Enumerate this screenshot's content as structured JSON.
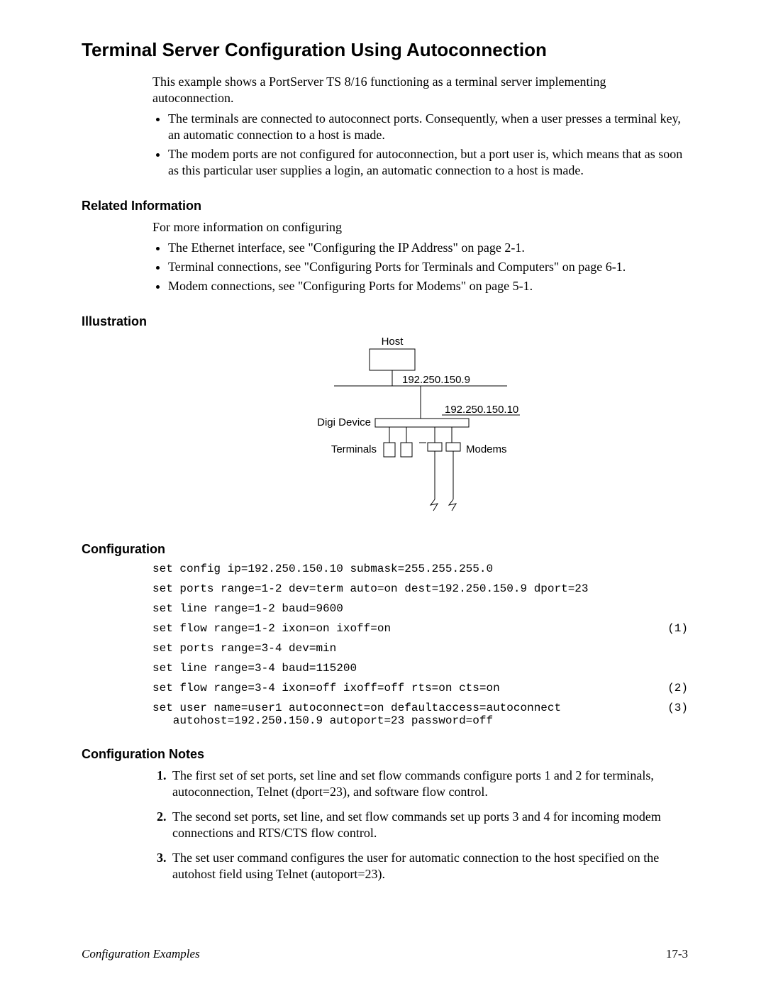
{
  "title": "Terminal Server Configuration Using Autoconnection",
  "intro": "This example shows a PortServer TS 8/16 functioning as a terminal server implementing autoconnection.",
  "intro_bullets": [
    "The terminals are connected to autoconnect ports. Consequently, when a user presses a terminal key, an automatic connection to a host is made.",
    "The modem ports are not configured for autoconnection, but a port user is, which means that as soon as this particular user supplies a login, an automatic connection to a host is made."
  ],
  "related": {
    "heading": "Related Information",
    "lead": "For more information on configuring",
    "items": [
      "The Ethernet interface, see \"Configuring the IP Address\" on page 2-1.",
      "Terminal connections, see \"Configuring Ports for Terminals and Computers\" on page 6-1.",
      "Modem connections, see \"Configuring Ports for Modems\" on page 5-1."
    ]
  },
  "illustration": {
    "heading": "Illustration",
    "labels": {
      "host": "Host",
      "host_ip": "192.250.150.9",
      "digi_ip": "192.250.150.10",
      "digi": "Digi Device",
      "terminals": "Terminals",
      "modems": "Modems"
    }
  },
  "configuration": {
    "heading": "Configuration",
    "lines": [
      {
        "cmd": "set config ip=192.250.150.10 submask=255.255.255.0",
        "num": ""
      },
      {
        "cmd": "set ports range=1-2 dev=term auto=on dest=192.250.150.9 dport=23",
        "num": ""
      },
      {
        "cmd": "set line range=1-2 baud=9600",
        "num": ""
      },
      {
        "cmd": "set flow range=1-2 ixon=on ixoff=on",
        "num": "(1)"
      },
      {
        "cmd": "set ports range=3-4 dev=min",
        "num": ""
      },
      {
        "cmd": "set line range=3-4 baud=115200",
        "num": ""
      },
      {
        "cmd": "set flow range=3-4 ixon=off ixoff=off rts=on cts=on",
        "num": "(2)"
      },
      {
        "cmd": "set user name=user1 autoconnect=on defaultaccess=autoconnect\n   autohost=192.250.150.9 autoport=23 password=off",
        "num": "(3)"
      }
    ]
  },
  "config_notes": {
    "heading": "Configuration Notes",
    "items": [
      "The first set of set ports, set line and set flow commands configure ports 1 and 2 for terminals, autoconnection, Telnet (dport=23), and software flow control.",
      "The second set ports, set line, and set flow commands set up ports 3 and 4 for incoming modem connections and RTS/CTS flow control.",
      "The set user command configures the user for automatic connection to the host specified on the autohost field using Telnet (autoport=23)."
    ]
  },
  "footer": {
    "left": "Configuration Examples",
    "right": "17-3"
  }
}
